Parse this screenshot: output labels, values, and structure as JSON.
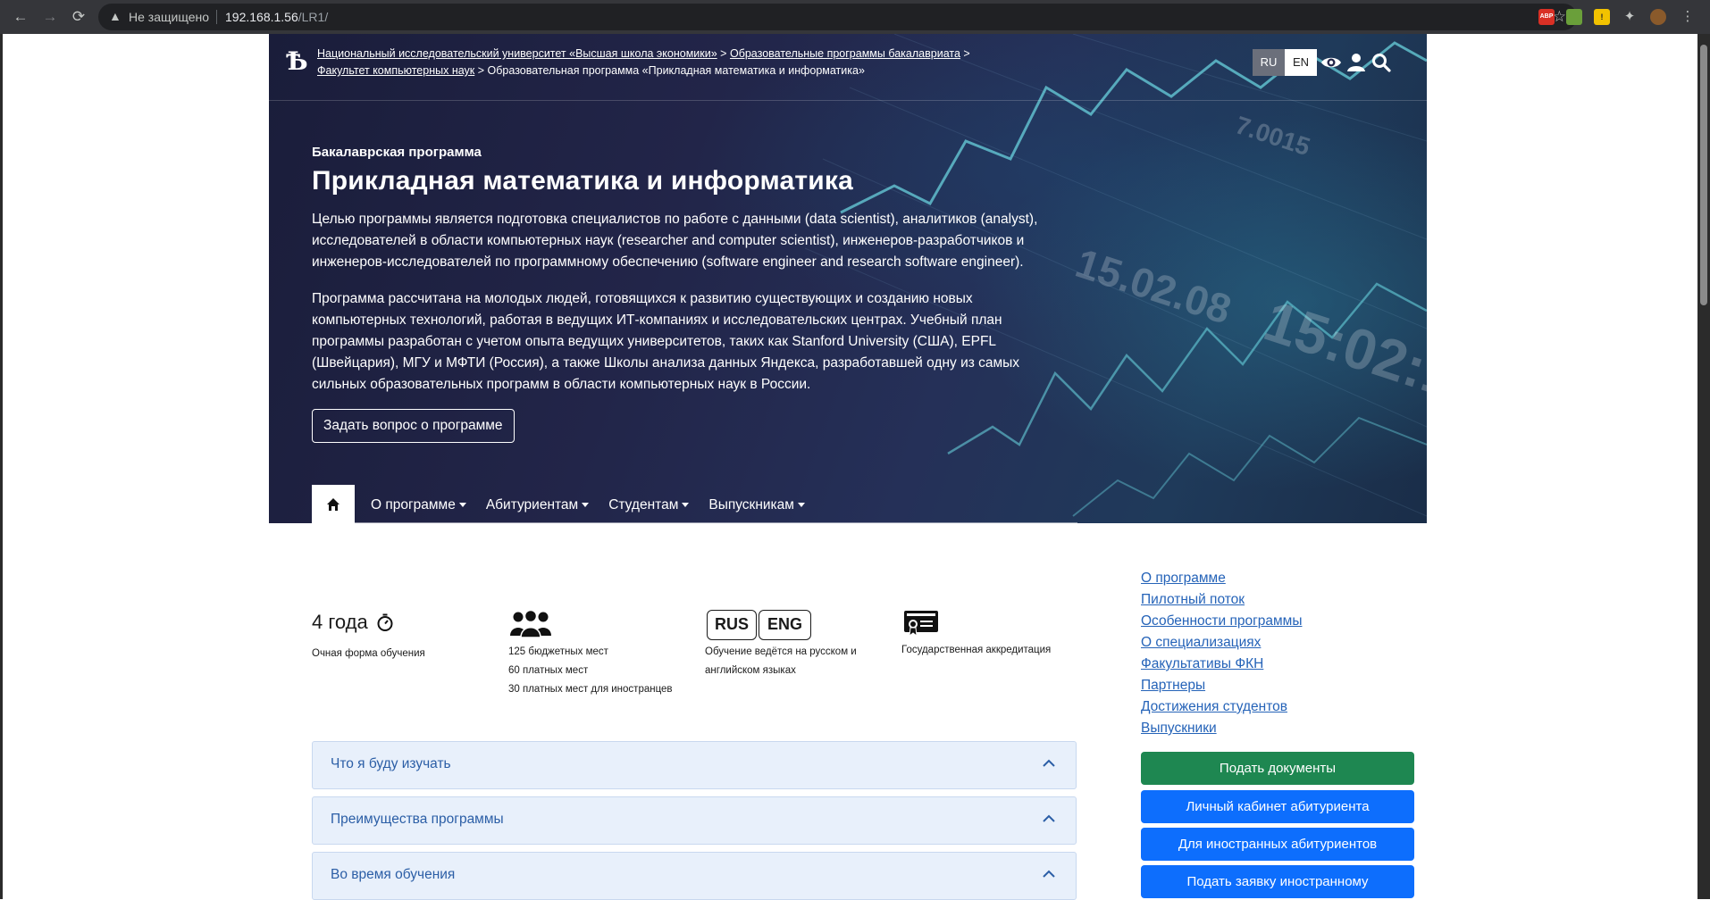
{
  "browser": {
    "insecure_label": "Не защищено",
    "url_host": "192.168.1.56",
    "url_path": "/LR1/",
    "ext_badge": "ABP"
  },
  "header": {
    "logo_text": "Ѣ",
    "breadcrumbs": [
      "Национальный исследовательский университет «Высшая школа экономики»",
      "Образовательные программы бакалавриата",
      "Факультет компьютерных наук",
      "Образовательная программа «Прикладная математика и информатика»"
    ],
    "crumb_sep": ">",
    "lang_ru": "RU",
    "lang_en": "EN"
  },
  "hero": {
    "kicker": "Бакалаврская программа",
    "title": "Прикладная математика и информатика",
    "paragraph1": "Целью программы является подготовка специалистов по работе с данными (data scientist), аналитиков (analyst), исследователей в области компьютерных наук (researcher and computer scientist), инженеров-разработчиков и инженеров-исследователей по программному обеспечению (software engineer and research software engineer).",
    "paragraph2": "Программа рассчитана на молодых людей, готовящихся к развитию существующих и созданию новых компьютерных технологий, работая в ведущих ИТ-компаниях и исследовательских центрах. Учебный план программы разработан с учетом опыта ведущих университетов, таких как Stanford University (США), EPFL (Швейцария), МГУ и МФТИ (Россия), а также Школы анализа данных Яндекса, разработавшей одну из самых сильных образовательных программ в области компьютерных наук в России.",
    "ask_button": "Задать вопрос о программе"
  },
  "tabs": [
    "О программе",
    "Абитуриентам",
    "Студентам",
    "Выпускникам"
  ],
  "stats": {
    "years": "4 года",
    "years_caption": "Очная форма обучения",
    "places": [
      "125 бюджетных мест",
      "60 платных мест",
      "30 платных мест для иностранцев"
    ],
    "lang_rus": "RUS",
    "lang_eng": "ENG",
    "lang_caption_1": "Обучение ведётся на русском и",
    "lang_caption_2": "английском языках",
    "accreditation": "Государственная аккредитация"
  },
  "accordion": [
    "Что я буду изучать",
    "Преимущества программы",
    "Во время обучения"
  ],
  "sidebar": {
    "links": [
      "О программе",
      "Пилотный поток",
      "Особенности программы",
      "О специализациях",
      "Факультативы ФКН",
      "Партнеры",
      "Достижения студентов",
      "Выпускники"
    ],
    "buttons": [
      {
        "label": "Подать документы",
        "color": "#1e8751"
      },
      {
        "label": "Личный кабинет абитуриента",
        "color": "#0d6efd"
      },
      {
        "label": "Для иностранных абитуриентов",
        "color": "#0d6efd"
      },
      {
        "label": "Подать заявку иностранному",
        "color": "#0d6efd"
      }
    ]
  }
}
